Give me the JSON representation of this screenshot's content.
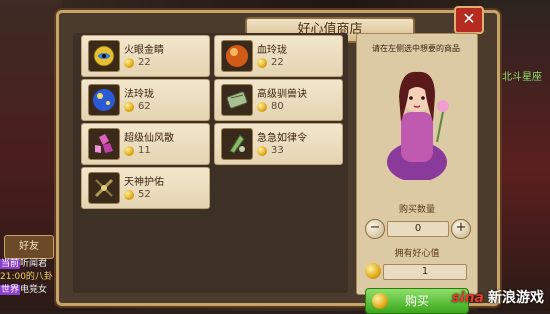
{
  "panel": {
    "title": "好心值商店",
    "close_label": "✕"
  },
  "items": [
    {
      "name": "火眼金睛",
      "price": "22",
      "icon": "eye-orb-icon",
      "color": "#e8c030"
    },
    {
      "name": "血玲珑",
      "price": "22",
      "icon": "blood-orb-icon",
      "color": "#d25a18"
    },
    {
      "name": "法玲珑",
      "price": "62",
      "icon": "blue-orb-icon",
      "color": "#2a5ad8"
    },
    {
      "name": "高级驯兽诀",
      "price": "80",
      "icon": "scroll-icon",
      "color": "#a8c090"
    },
    {
      "name": "超级仙风散",
      "price": "11",
      "icon": "pink-crystal-icon",
      "color": "#e060c0"
    },
    {
      "name": "急急如律令",
      "price": "33",
      "icon": "talisman-icon",
      "color": "#8ab86a"
    },
    {
      "name": "天神护佑",
      "price": "52",
      "icon": "blessing-icon",
      "color": "#b09a50"
    }
  ],
  "sidebar": {
    "hint": "请在左侧选中想要的商品",
    "quantity_label": "购买数量",
    "quantity_value": "0",
    "minus": "−",
    "plus": "+",
    "goodwill_label": "拥有好心值",
    "goodwill_value": "1",
    "buy_label": "购买"
  },
  "background": {
    "right_title": "北斗星座",
    "left_button": "好友",
    "chat": [
      {
        "tag": "当前",
        "text": "听闻君"
      },
      {
        "tag": "",
        "text": "21:00的八卦"
      },
      {
        "tag": "世界",
        "text": "电竞女"
      }
    ]
  },
  "watermark": {
    "logo": "sina",
    "text": "新浪游戏"
  }
}
